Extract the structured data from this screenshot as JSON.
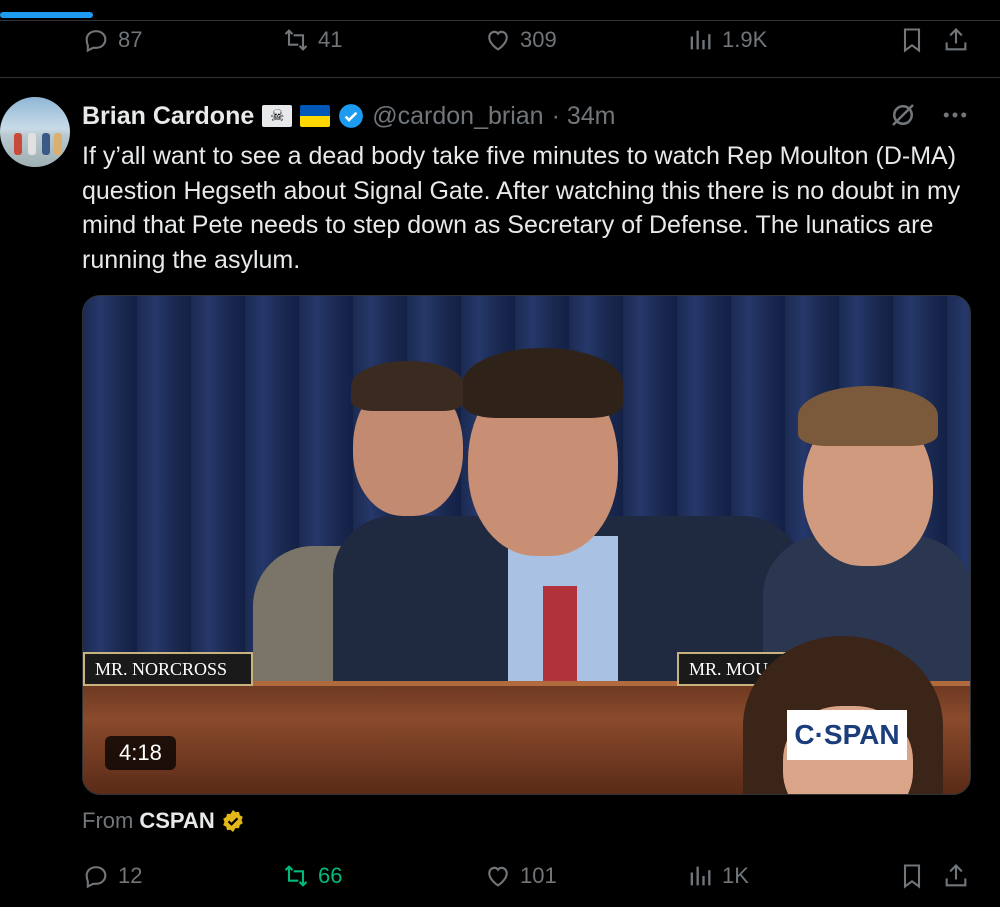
{
  "top_actions": {
    "replies": "87",
    "retweets": "41",
    "likes": "309",
    "views": "1.9K"
  },
  "tweet": {
    "author_name": "Brian Cardone",
    "handle": "@cardon_brian",
    "time": "· 34m",
    "flag_skull": "☠",
    "text": "If y’all want to see a dead body take five minutes to watch Rep Moulton  (D-MA) question Hegseth about Signal Gate. After watching this there is no doubt in my mind that Pete needs to step down as Secretary of Defense. The lunatics are running the asylum.",
    "media": {
      "duration": "4:18",
      "nameplate_left": "MR. NORCROSS",
      "nameplate_right": "MR. MOU",
      "broadcaster_logo": "C·SPAN"
    },
    "source_prefix": "From",
    "source_name": "CSPAN",
    "actions": {
      "replies": "12",
      "retweets": "66",
      "likes": "101",
      "views": "1K"
    }
  },
  "colors": {
    "accent": "#1d9bf0",
    "retweet_active": "#00ba7c",
    "muted": "#71767b",
    "gold_verified": "#e2b719"
  },
  "icons": [
    "reply-icon",
    "retweet-icon",
    "like-icon",
    "views-icon",
    "bookmark-icon",
    "share-icon",
    "grok-icon",
    "more-icon",
    "verified-icon"
  ]
}
